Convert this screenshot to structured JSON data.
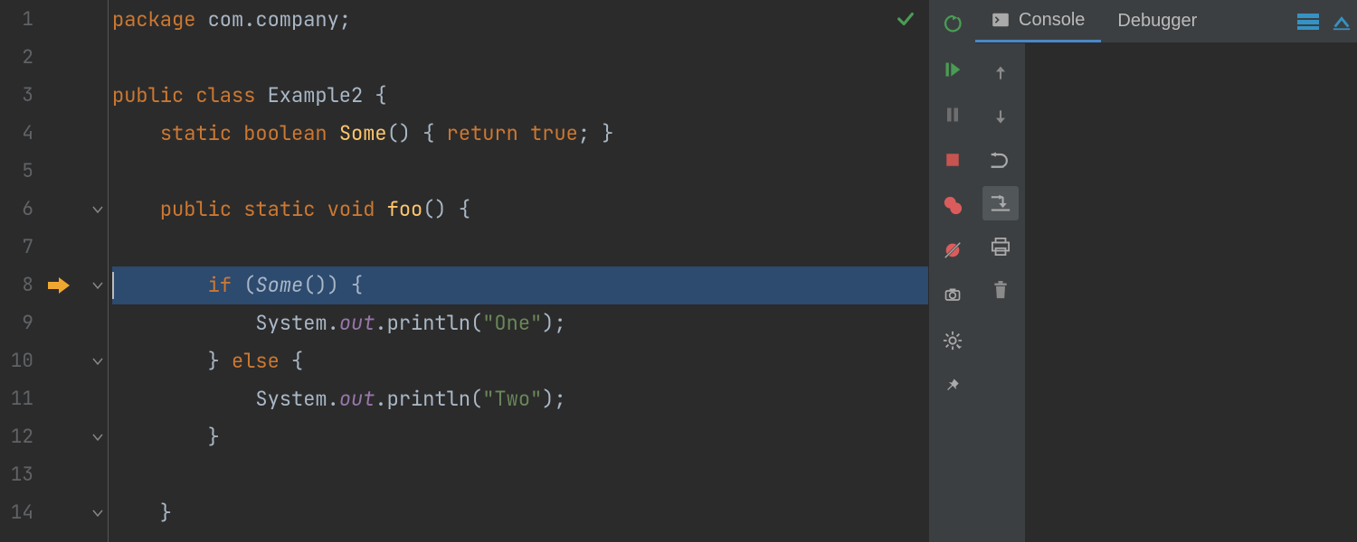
{
  "editor": {
    "lines": [
      1,
      2,
      3,
      4,
      5,
      6,
      7,
      8,
      9,
      10,
      11,
      12,
      13,
      14
    ],
    "execution_line": 8,
    "fold_markers_at": [
      6,
      8,
      10,
      12,
      14
    ],
    "code": {
      "1": [
        {
          "t": "package",
          "c": "kw"
        },
        {
          "t": " com.company",
          "c": "cls"
        },
        {
          "t": ";",
          "c": "paren"
        }
      ],
      "2": [],
      "3": [
        {
          "t": "public class",
          "c": "kw"
        },
        {
          "t": " Example2 ",
          "c": "cls"
        },
        {
          "t": "{",
          "c": "paren"
        }
      ],
      "4": [
        {
          "t": "    ",
          "c": ""
        },
        {
          "t": "static boolean",
          "c": "kw"
        },
        {
          "t": " ",
          "c": ""
        },
        {
          "t": "Some",
          "c": "method"
        },
        {
          "t": "()",
          "c": "paren"
        },
        {
          "t": " ",
          "c": ""
        },
        {
          "t": "{ ",
          "c": "paren"
        },
        {
          "t": "return true",
          "c": "kw"
        },
        {
          "t": "; }",
          "c": "paren"
        }
      ],
      "5": [],
      "6": [
        {
          "t": "    ",
          "c": ""
        },
        {
          "t": "public static void",
          "c": "kw"
        },
        {
          "t": " ",
          "c": ""
        },
        {
          "t": "foo",
          "c": "method"
        },
        {
          "t": "()",
          "c": "paren"
        },
        {
          "t": " ",
          "c": ""
        },
        {
          "t": "{",
          "c": "paren"
        }
      ],
      "7": [],
      "8": [
        {
          "t": "        ",
          "c": ""
        },
        {
          "t": "if",
          "c": "kw"
        },
        {
          "t": " (",
          "c": "paren"
        },
        {
          "t": "Some",
          "c": "call-it"
        },
        {
          "t": "()) {",
          "c": "paren"
        }
      ],
      "9": [
        {
          "t": "            ",
          "c": ""
        },
        {
          "t": "System.",
          "c": "cls"
        },
        {
          "t": "out",
          "c": "field"
        },
        {
          "t": ".println(",
          "c": "cls"
        },
        {
          "t": "\"One\"",
          "c": "str"
        },
        {
          "t": ");",
          "c": "cls"
        }
      ],
      "10": [
        {
          "t": "        } ",
          "c": "paren"
        },
        {
          "t": "else",
          "c": "kw"
        },
        {
          "t": " {",
          "c": "paren"
        }
      ],
      "11": [
        {
          "t": "            ",
          "c": ""
        },
        {
          "t": "System.",
          "c": "cls"
        },
        {
          "t": "out",
          "c": "field"
        },
        {
          "t": ".println(",
          "c": "cls"
        },
        {
          "t": "\"Two\"",
          "c": "str"
        },
        {
          "t": ");",
          "c": "cls"
        }
      ],
      "12": [
        {
          "t": "        }",
          "c": "paren"
        }
      ],
      "13": [],
      "14": [
        {
          "t": "    }",
          "c": "paren"
        }
      ]
    }
  },
  "inspection_status": "ok",
  "run_toolbar": [
    "rerun",
    "resume",
    "pause",
    "stop",
    "breakpoints",
    "mute-breakpoints",
    "camera",
    "settings",
    "pin"
  ],
  "debugger_actions": [
    "step-over",
    "step-into",
    "step-into-my",
    "step-out",
    "print",
    "trash"
  ],
  "panel_tabs": {
    "active": "Console",
    "items": [
      "Console",
      "Debugger"
    ]
  }
}
